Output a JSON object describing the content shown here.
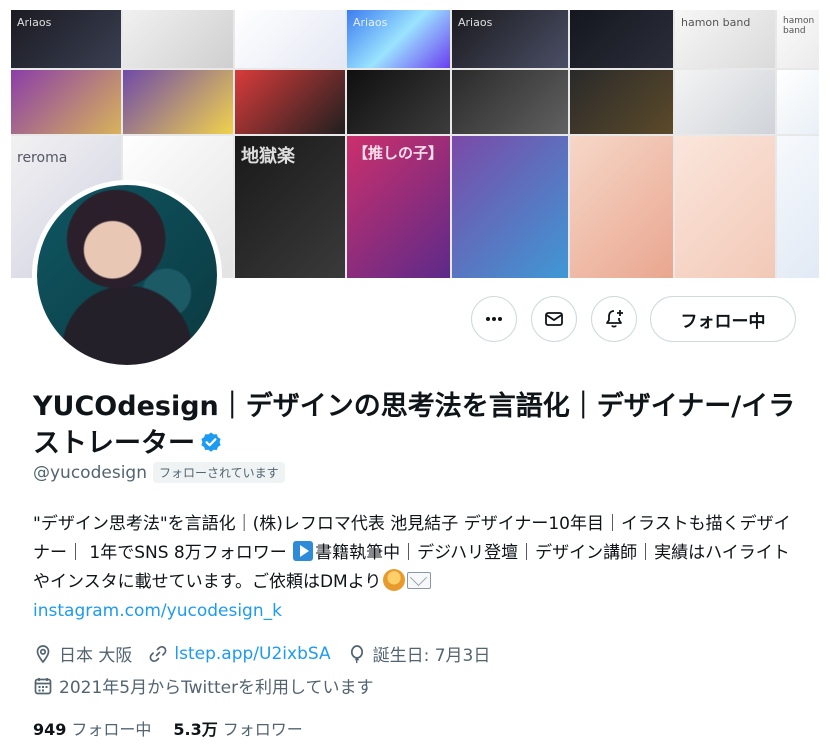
{
  "banner": {
    "tiles": [
      {
        "label": "Ariaos"
      },
      {
        "label": ""
      },
      {
        "label": ""
      },
      {
        "label": "Ariaos"
      },
      {
        "label": "Ariaos"
      },
      {
        "label": ""
      },
      {
        "label": ""
      },
      {
        "label": "hamon band"
      },
      {
        "label": "hamon band"
      },
      {
        "label": ""
      },
      {
        "label": ""
      },
      {
        "label": ""
      },
      {
        "label": ""
      },
      {
        "label": ""
      },
      {
        "label": ""
      },
      {
        "label": ""
      },
      {
        "label": "reroma"
      },
      {
        "label": ""
      },
      {
        "label": "地獄楽"
      },
      {
        "label": "【推しの子】"
      },
      {
        "label": ""
      },
      {
        "label": ""
      },
      {
        "label": ""
      },
      {
        "label": ""
      },
      {
        "label": ""
      }
    ]
  },
  "actions": {
    "follow_label": "フォロー中"
  },
  "profile": {
    "name": "YUCOdesign｜デザインの思考法を言語化｜デザイナー/イラストレーター",
    "handle": "@yucodesign",
    "follows_you": "フォローされています",
    "bio_text_1": "\"デザイン思考法\"を言語化｜(株)レフロマ代表 池見結子 デザイナー10年目｜イラストも描くデザイナー｜ 1年でSNS 8万フォロワー ",
    "bio_text_2": "書籍執筆中｜デジハリ登壇｜デザイン講師｜実績はハイライトやインスタに載せています。ご依頼はDMより",
    "bio_link": "instagram.com/yucodesign_k",
    "location": "日本 大阪",
    "website": "lstep.app/U2ixbSA",
    "birthday": "誕生日: 7月3日",
    "joined": "2021年5月からTwitterを利用しています"
  },
  "stats": {
    "following_count": "949",
    "following_label": "フォロー中",
    "followers_count": "5.3万",
    "followers_label": "フォロワー"
  },
  "colors": {
    "accent": "#1d9bf0",
    "verified": "#1d9bf0",
    "secondary_text": "#536471"
  }
}
